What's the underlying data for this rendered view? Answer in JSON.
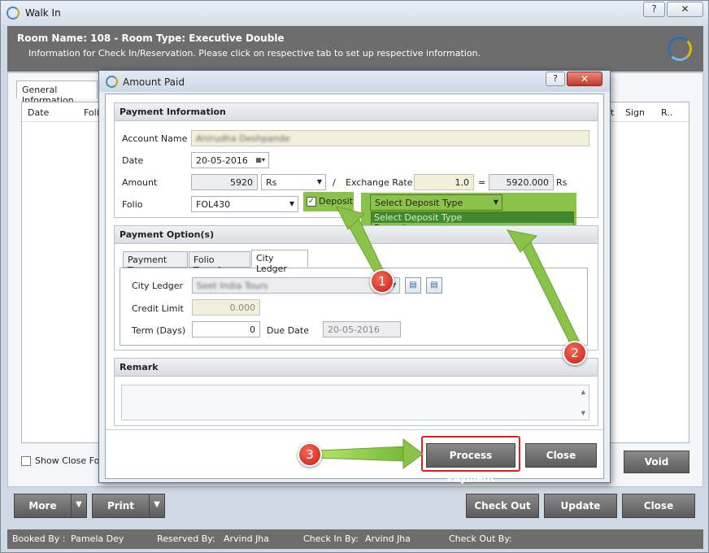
{
  "window": {
    "title": "Walk In",
    "help_label": "?",
    "close_label": "✕"
  },
  "header": {
    "room_title": "Room Name: 108 - Room Type: Executive Double",
    "subtitle": "Information for Check In/Reservation. Please click on respective tab to set up respective information."
  },
  "background": {
    "tab_label": "General Information",
    "columns": {
      "date": "Date",
      "folio": "Folio",
      "t": "t",
      "sign": "Sign",
      "r": "R.."
    },
    "show_closed": "Show Close Folio",
    "void_label": "Void"
  },
  "footer": {
    "more": "More",
    "print": "Print",
    "check_out": "Check Out",
    "update": "Update",
    "close": "Close",
    "split_arrow": "▼"
  },
  "status": {
    "booked_by_label": "Booked By :",
    "booked_by": "Pamela Dey",
    "reserved_by_label": "Reserved By:",
    "reserved_by": "Arvind Jha",
    "check_in_by_label": "Check In By:",
    "check_in_by": "Arvind Jha",
    "check_out_by_label": "Check Out By:"
  },
  "dialog": {
    "title": "Amount Paid",
    "help_label": "?",
    "close_label": "✕",
    "payment_info": {
      "heading": "Payment Information",
      "account_name_label": "Account Name",
      "account_name": "Anirudha Deshpande",
      "date_label": "Date",
      "date": "20-05-2016",
      "amount_label": "Amount",
      "amount": "5920",
      "currency": "Rs",
      "divider": "/",
      "exchange_rate_label": "Exchange Rate",
      "exchange_rate": "1.0",
      "equals": "=",
      "converted": "5920.000",
      "converted_currency": "Rs",
      "folio_label": "Folio",
      "folio": "FOL430",
      "deposit_label": "Deposit",
      "deposit_checked": true,
      "deposit_type_selected": "Select Deposit Type",
      "deposit_type_options": [
        "Select Deposit Type",
        "Deposit"
      ]
    },
    "payment_options": {
      "heading": "Payment Option(s)",
      "tabs": [
        "Payment Type",
        "Folio Transfer",
        "City Ledger"
      ],
      "active_tab": "City Ledger",
      "city_ledger_label": "City Ledger",
      "city_ledger_value": "Seet India Tours",
      "credit_limit_label": "Credit Limit",
      "credit_limit": "0.000",
      "term_label": "Term (Days)",
      "term": "0",
      "due_date_label": "Due Date",
      "due_date": "20-05-2016"
    },
    "remark": {
      "heading": "Remark"
    },
    "buttons": {
      "process_payment": "Process Payment",
      "close": "Close"
    }
  },
  "annotations": [
    "1",
    "2",
    "3"
  ],
  "colors": {
    "highlight_green": "#8bc34a",
    "badge_red": "#d32f2f",
    "header_grey": "#6d6d6d"
  }
}
